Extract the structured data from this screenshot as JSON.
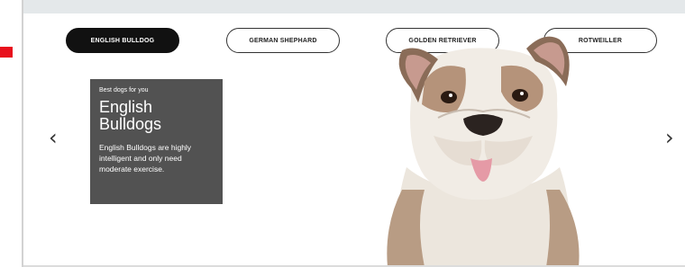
{
  "tabs": [
    {
      "label": "ENGLISH BULLDOG",
      "active": true
    },
    {
      "label": "GERMAN SHEPHARD",
      "active": false
    },
    {
      "label": "GOLDEN RETRIEVER",
      "active": false
    },
    {
      "label": "ROTWEILLER",
      "active": false
    }
  ],
  "hero": {
    "eyebrow": "Best dogs for you",
    "title_line1": "English",
    "title_line2": "Bulldogs",
    "description": "English Bulldogs are highly intelligent and only need moderate exercise."
  },
  "nav": {
    "prev_icon": "chevron-left-icon",
    "next_icon": "chevron-right-icon",
    "prev_glyph": "‹",
    "next_glyph": "›"
  },
  "colors": {
    "accent_red": "#e8101c",
    "active_tab_bg": "#111111",
    "infobox_bg": "#525252"
  },
  "image": {
    "subject": "english-bulldog-photo"
  }
}
